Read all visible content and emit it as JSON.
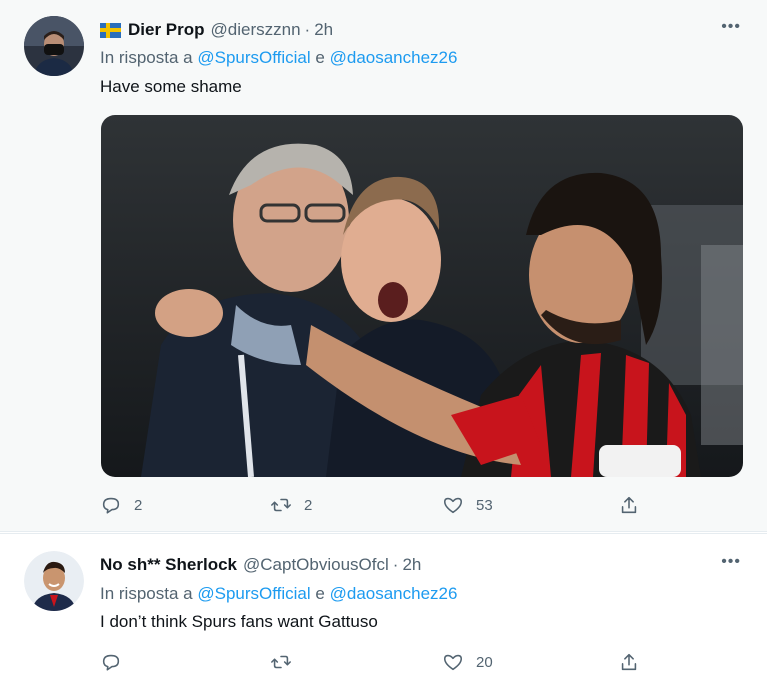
{
  "tweets": [
    {
      "display_name": "Dier Prop",
      "handle": "@dierszznn",
      "time": "2h",
      "reply_prefix": "In risposta a",
      "mention1": "@SpursOfficial",
      "reply_joiner": "e",
      "mention2": "@daosanchez26",
      "text": "Have some shame",
      "counts": {
        "replies": "2",
        "retweets": "2",
        "likes": "53"
      }
    },
    {
      "display_name": "No sh** Sherlock",
      "handle": "@CaptObviousOfcl",
      "time": "2h",
      "reply_prefix": "In risposta a",
      "mention1": "@SpursOfficial",
      "reply_joiner": "e",
      "mention2": "@daosanchez26",
      "text": "I don’t think Spurs fans want Gattuso",
      "counts": {
        "replies": "",
        "retweets": "",
        "likes": "20"
      }
    }
  ],
  "dot_separator": "·",
  "more_glyph": "•••",
  "icons": [
    "flag-sweden-icon",
    "reply-icon",
    "retweet-icon",
    "like-icon",
    "share-icon",
    "more-icon"
  ],
  "colors": {
    "link": "#1d9bf0",
    "secondary": "#536471",
    "text": "#0f1419"
  }
}
